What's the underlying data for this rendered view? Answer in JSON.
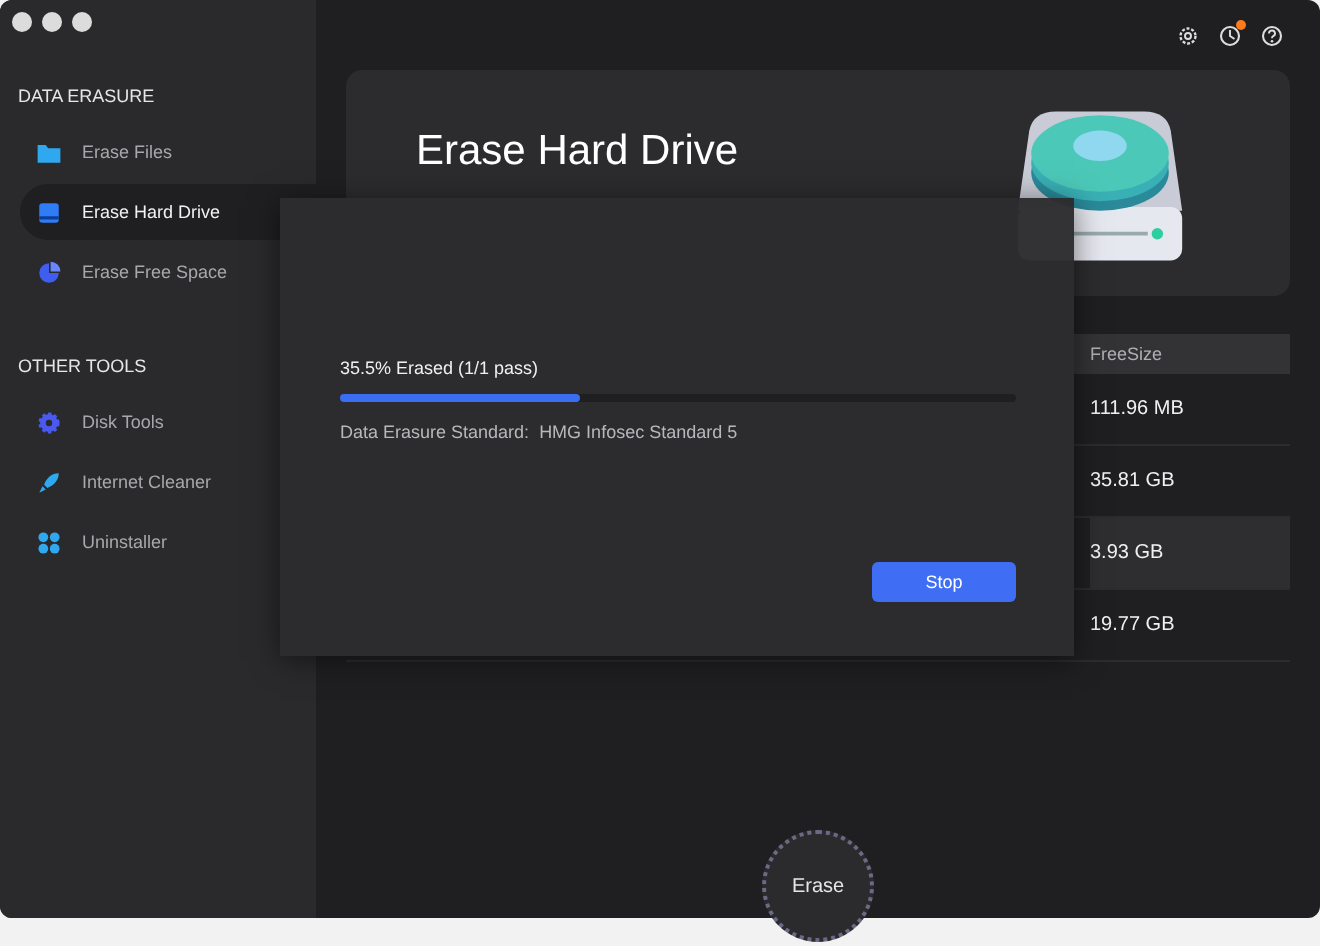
{
  "sidebar": {
    "sections": [
      {
        "heading": "DATA ERASURE",
        "items": [
          {
            "label": "Erase Files",
            "selected": false
          },
          {
            "label": "Erase Hard Drive",
            "selected": true
          },
          {
            "label": "Erase Free Space",
            "selected": false
          }
        ]
      },
      {
        "heading": "OTHER TOOLS",
        "items": [
          {
            "label": "Disk Tools",
            "selected": false
          },
          {
            "label": "Internet Cleaner",
            "selected": false
          },
          {
            "label": "Uninstaller",
            "selected": false
          }
        ]
      }
    ]
  },
  "toolbar": {
    "notification_dot": true
  },
  "header": {
    "title": "Erase Hard Drive"
  },
  "table": {
    "columns": [
      "FreeSize"
    ],
    "rows": [
      {
        "free_size": "111.96 MB",
        "selected": false
      },
      {
        "free_size": "35.81 GB",
        "selected": false
      },
      {
        "free_size": "3.93 GB",
        "selected": true
      },
      {
        "free_size": "19.77 GB",
        "selected": false
      }
    ]
  },
  "dialog": {
    "progress_label": "35.5% Erased (1/1 pass)",
    "level": 0.355,
    "standard_label": "Data Erasure Standard:",
    "standard_value": "HMG Infosec Standard 5",
    "button": "Stop"
  },
  "erase_button": "Erase"
}
